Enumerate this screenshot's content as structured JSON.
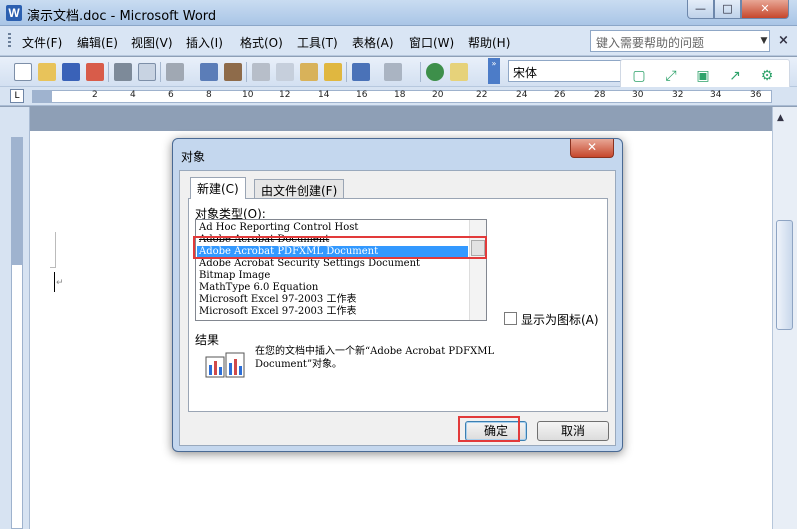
{
  "window": {
    "title": "演示文档.doc - Microsoft Word",
    "app_icon_letter": "W"
  },
  "window_controls": {
    "minimize": "—",
    "maximize": "□",
    "close": "✕"
  },
  "menu": {
    "items": [
      "文件(F)",
      "编辑(E)",
      "视图(V)",
      "插入(I)",
      "格式(O)",
      "工具(T)",
      "表格(A)",
      "窗口(W)",
      "帮助(H)"
    ],
    "help_placeholder": "键入需要帮助的问题",
    "help_arrow": "▼",
    "close": "×"
  },
  "toolbar": {
    "font_name": "宋体",
    "overflow": "»"
  },
  "ruler": {
    "corner": "L",
    "labels": [
      "2",
      "4",
      "6",
      "8",
      "10",
      "12",
      "14",
      "16",
      "18",
      "20",
      "22",
      "24",
      "26",
      "28",
      "30",
      "32",
      "34",
      "36"
    ]
  },
  "dialog": {
    "title": "对象",
    "close": "✕",
    "tabs": [
      "新建(C)",
      "由文件创建(F)"
    ],
    "type_label": "对象类型(O):",
    "object_types": [
      "Ad Hoc Reporting Control Host",
      "Adobe Acrobat Document",
      "Adobe Acrobat PDFXML Document",
      "Adobe Acrobat Security Settings Document",
      "Bitmap Image",
      "MathType 6.0 Equation",
      "Microsoft Excel 97-2003 工作表",
      "Microsoft Excel 97-2003 工作表"
    ],
    "selected_index": 2,
    "display_as_icon_label": "显示为图标(A)",
    "display_as_icon_checked": false,
    "result_label": "结果",
    "result_text": "在您的文档中插入一个新“Adobe Acrobat PDFXML Document”对象。",
    "ok_label": "确定",
    "cancel_label": "取消"
  },
  "colors": {
    "selection": "#3399ff",
    "highlight": "#e23a3a",
    "close_red": "#c6472c"
  }
}
